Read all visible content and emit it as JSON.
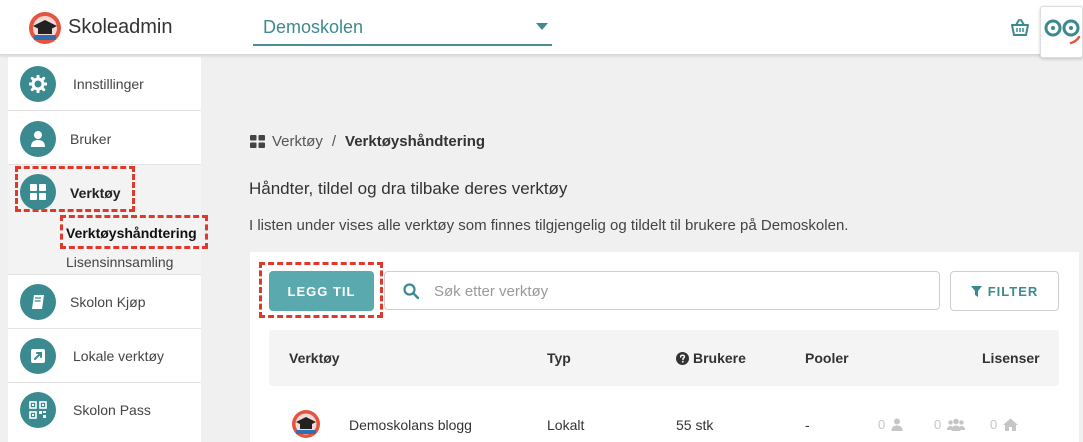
{
  "header": {
    "app_title": "Skoleadmin",
    "school": "Demoskolen"
  },
  "sidebar": {
    "items": [
      {
        "label": "Innstillinger",
        "icon": "gear-icon"
      },
      {
        "label": "Bruker",
        "icon": "user-icon"
      },
      {
        "label": "Verktøy",
        "icon": "grid-icon"
      },
      {
        "label": "Skolon Kjøp",
        "icon": "book-icon"
      },
      {
        "label": "Lokale verktøy",
        "icon": "external-link-icon"
      },
      {
        "label": "Skolon Pass",
        "icon": "qr-code-icon"
      }
    ],
    "subitems": [
      {
        "label": "Verktøyshåndtering"
      },
      {
        "label": "Lisensinnsamling"
      }
    ]
  },
  "breadcrumb": {
    "root": "Verktøy",
    "separator": "/",
    "current": "Verktøyshåndtering"
  },
  "main": {
    "heading": "Håndter, tildel og dra tilbake deres verktøy",
    "description": "I listen under vises alle verktøy som finnes tilgjengelig og tildelt til brukere på Demoskolen.",
    "add_button": "LEGG TIL",
    "search_placeholder": "Søk etter verktøy",
    "filter_button": "FILTER"
  },
  "table": {
    "columns": [
      "Verktøy",
      "Typ",
      "Brukere",
      "Pooler",
      "Lisenser"
    ],
    "rows": [
      {
        "name": "Demoskolans blogg",
        "type": "Lokalt",
        "users": "55 stk",
        "pools": "-",
        "licenses": [
          "0",
          "0",
          "0"
        ]
      }
    ]
  },
  "colors": {
    "accent": "#3b8a8f",
    "button": "#5aa9ae",
    "highlight": "#e0392b"
  }
}
